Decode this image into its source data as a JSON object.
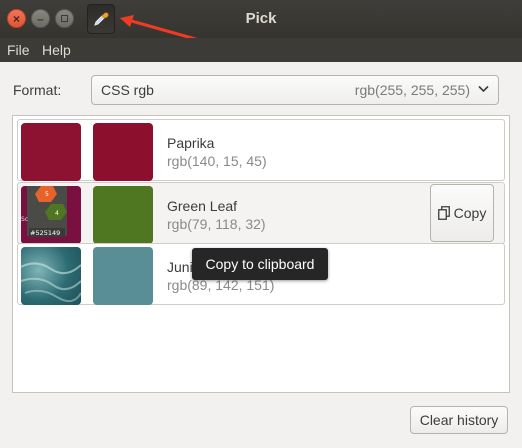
{
  "window": {
    "title": "Pick"
  },
  "menu": {
    "items": [
      "File",
      "Help"
    ]
  },
  "format": {
    "label": "Format:",
    "selected": "CSS rgb",
    "preview": "rgb(255, 255, 255)"
  },
  "history": [
    {
      "name": "Paprika",
      "value": "rgb(140, 15, 45)",
      "color": "#8c0f2d",
      "thumb_color": "#8d1130"
    },
    {
      "name": "Green Leaf",
      "value": "rgb(79, 118, 32)",
      "color": "#4f7620",
      "thumb_label": "#525149"
    },
    {
      "name": "Jungle Mist",
      "visible_name": "Juni",
      "value": "rgb(89, 142, 151)",
      "color": "#598e97"
    }
  ],
  "copy_button": {
    "label": "Copy"
  },
  "tooltip": {
    "text": "Copy to clipboard"
  },
  "clear_button": {
    "label": "Clear history"
  }
}
